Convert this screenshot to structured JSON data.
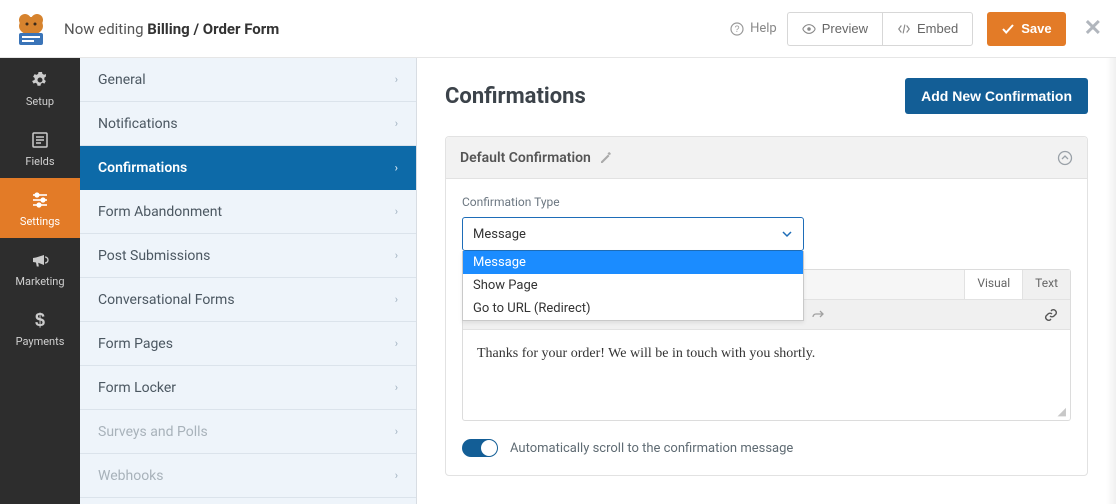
{
  "header": {
    "editing_prefix": "Now editing ",
    "form_name": "Billing / Order Form",
    "help_label": "Help",
    "preview_label": "Preview",
    "embed_label": "Embed",
    "save_label": "Save"
  },
  "rail": {
    "items": [
      {
        "id": "setup",
        "label": "Setup",
        "icon": "gear-icon"
      },
      {
        "id": "fields",
        "label": "Fields",
        "icon": "fields-icon"
      },
      {
        "id": "settings",
        "label": "Settings",
        "icon": "sliders-icon",
        "active": true
      },
      {
        "id": "marketing",
        "label": "Marketing",
        "icon": "megaphone-icon"
      },
      {
        "id": "payments",
        "label": "Payments",
        "icon": "dollar-icon"
      }
    ]
  },
  "settings_panel": {
    "items": [
      {
        "label": "General"
      },
      {
        "label": "Notifications"
      },
      {
        "label": "Confirmations",
        "active": true
      },
      {
        "label": "Form Abandonment"
      },
      {
        "label": "Post Submissions"
      },
      {
        "label": "Conversational Forms"
      },
      {
        "label": "Form Pages"
      },
      {
        "label": "Form Locker"
      },
      {
        "label": "Surveys and Polls",
        "disabled": true
      },
      {
        "label": "Webhooks",
        "disabled": true
      }
    ]
  },
  "main": {
    "heading": "Confirmations",
    "add_button": "Add New Confirmation",
    "card": {
      "title": "Default Confirmation",
      "field_label": "Confirmation Type",
      "selected_value": "Message",
      "options": [
        "Message",
        "Show Page",
        "Go to URL (Redirect)"
      ],
      "editor_tabs": {
        "visual": "Visual",
        "text": "Text"
      },
      "editor_content": "Thanks for your order! We will be in touch with you shortly.",
      "toggle_label": "Automatically scroll to the confirmation message",
      "toggle_on": true
    }
  }
}
